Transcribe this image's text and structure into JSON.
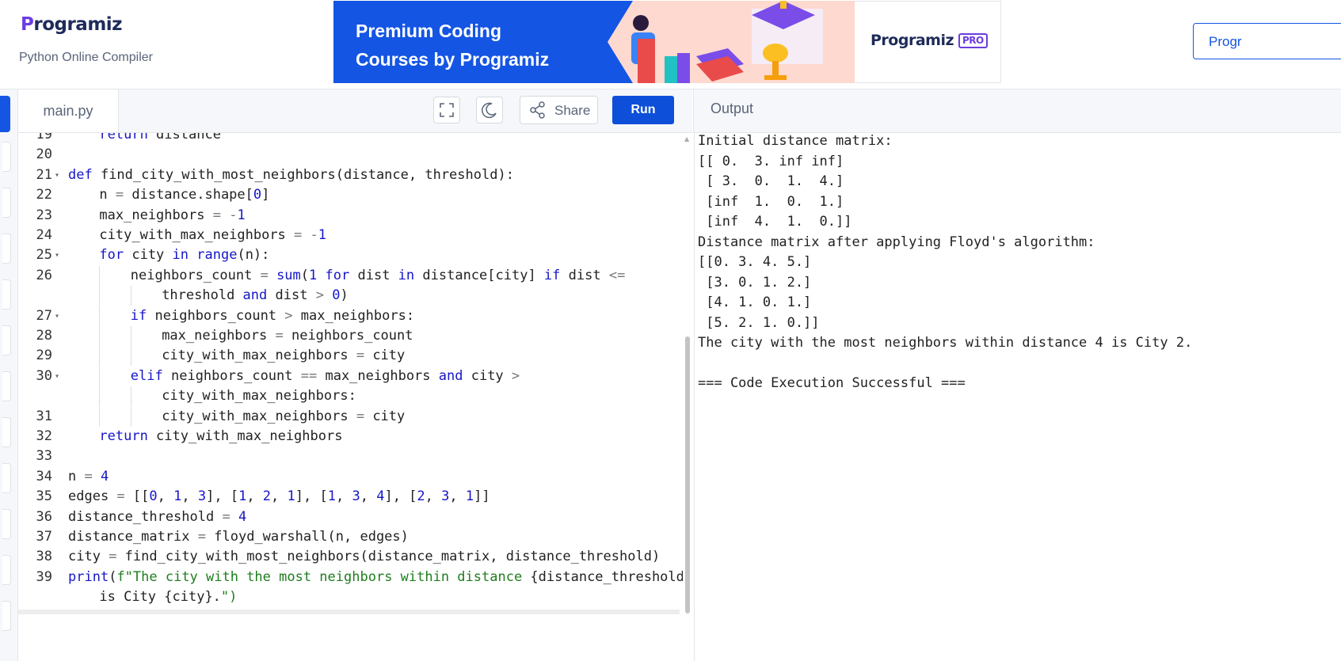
{
  "header": {
    "logo": "Programiz",
    "subtitle": "Python Online Compiler",
    "banner_line1": "Premium Coding",
    "banner_line2": "Courses by Programiz",
    "pro_logo": "Programiz",
    "pro_badge": "PRO",
    "right_button": "Progr"
  },
  "toolbar": {
    "tab": "main.py",
    "share": "Share",
    "run": "Run",
    "output_title": "Output"
  },
  "editor": {
    "lines": [
      {
        "n": "19",
        "fold": false,
        "indent": 1,
        "text": "return distance"
      },
      {
        "n": "20",
        "fold": false,
        "indent": 0,
        "text": ""
      },
      {
        "n": "21",
        "fold": true,
        "indent": 0,
        "text": "def find_city_with_most_neighbors(distance, threshold):"
      },
      {
        "n": "22",
        "fold": false,
        "indent": 1,
        "text": "n = distance.shape[0]"
      },
      {
        "n": "23",
        "fold": false,
        "indent": 1,
        "text": "max_neighbors = -1"
      },
      {
        "n": "24",
        "fold": false,
        "indent": 1,
        "text": "city_with_max_neighbors = -1"
      },
      {
        "n": "25",
        "fold": true,
        "indent": 1,
        "text": "for city in range(n):"
      },
      {
        "n": "26",
        "fold": false,
        "indent": 2,
        "text": "neighbors_count = sum(1 for dist in distance[city] if dist <="
      },
      {
        "n": "",
        "fold": false,
        "indent": 3,
        "text": "threshold and dist > 0)"
      },
      {
        "n": "27",
        "fold": true,
        "indent": 2,
        "text": "if neighbors_count > max_neighbors:"
      },
      {
        "n": "28",
        "fold": false,
        "indent": 3,
        "text": "max_neighbors = neighbors_count"
      },
      {
        "n": "29",
        "fold": false,
        "indent": 3,
        "text": "city_with_max_neighbors = city"
      },
      {
        "n": "30",
        "fold": true,
        "indent": 2,
        "text": "elif neighbors_count == max_neighbors and city >"
      },
      {
        "n": "",
        "fold": false,
        "indent": 3,
        "text": "city_with_max_neighbors:"
      },
      {
        "n": "31",
        "fold": false,
        "indent": 3,
        "text": "city_with_max_neighbors = city"
      },
      {
        "n": "32",
        "fold": false,
        "indent": 1,
        "text": "return city_with_max_neighbors"
      },
      {
        "n": "33",
        "fold": false,
        "indent": 0,
        "text": ""
      },
      {
        "n": "34",
        "fold": false,
        "indent": 0,
        "text": "n = 4"
      },
      {
        "n": "35",
        "fold": false,
        "indent": 0,
        "text": "edges = [[0, 1, 3], [1, 2, 1], [1, 3, 4], [2, 3, 1]]"
      },
      {
        "n": "36",
        "fold": false,
        "indent": 0,
        "text": "distance_threshold = 4"
      },
      {
        "n": "37",
        "fold": false,
        "indent": 0,
        "text": "distance_matrix = floyd_warshall(n, edges)"
      },
      {
        "n": "38",
        "fold": false,
        "indent": 0,
        "text": "city = find_city_with_most_neighbors(distance_matrix, distance_threshold)"
      },
      {
        "n": "39",
        "fold": false,
        "indent": 0,
        "text": "print(f\"The city with the most neighbors within distance {distance_threshold}"
      },
      {
        "n": "",
        "fold": false,
        "indent": 1,
        "text": "is City {city}.\")"
      }
    ]
  },
  "output": {
    "lines": [
      "Initial distance matrix:",
      "[[ 0.  3. inf inf]",
      " [ 3.  0.  1.  4.]",
      " [inf  1.  0.  1.]",
      " [inf  4.  1.  0.]]",
      "Distance matrix after applying Floyd's algorithm:",
      "[[0. 3. 4. 5.]",
      " [3. 0. 1. 2.]",
      " [4. 1. 0. 1.]",
      " [5. 2. 1. 0.]]",
      "The city with the most neighbors within distance 4 is City 2.",
      "",
      "=== Code Execution Successful ==="
    ]
  },
  "icons": [
    "fullscreen-icon",
    "dark-mode-icon",
    "share-icon"
  ],
  "colors": {
    "accent": "#0d4fd8",
    "keyword": "#1616c8",
    "string": "#1e7d1e",
    "brand": "#6b3de0"
  }
}
